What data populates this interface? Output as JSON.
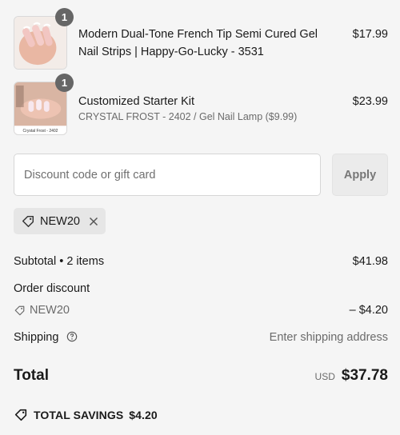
{
  "items": [
    {
      "quantity": "1",
      "title": "Modern Dual-Tone French Tip Semi Cured Gel Nail Strips | Happy-Go-Lucky - 3531",
      "subtitle": "",
      "price": "$17.99"
    },
    {
      "quantity": "1",
      "title": "Customized Starter Kit",
      "subtitle": "CRYSTAL FROST - 2402 / Gel Nail Lamp ($9.99)",
      "price": "$23.99",
      "thumb_caption": "Crystal Frost - 2402"
    }
  ],
  "discount": {
    "placeholder": "Discount code or gift card",
    "apply_label": "Apply",
    "applied_code": "NEW20"
  },
  "summary": {
    "subtotal_label": "Subtotal • 2 items",
    "subtotal_value": "$41.98",
    "order_discount_label": "Order discount",
    "discount_code": "NEW20",
    "discount_value": "– $4.20",
    "shipping_label": "Shipping",
    "shipping_value": "Enter shipping address",
    "total_label": "Total",
    "currency": "USD",
    "total_value": "$37.78",
    "savings_label": "TOTAL SAVINGS",
    "savings_value": "$4.20"
  },
  "icons": [
    "tag-icon",
    "close-icon",
    "help-icon",
    "savings-tag-icon"
  ],
  "colors": {
    "badge": "#666666",
    "chip": "#e6e6e6",
    "background": "#f5f5f5"
  }
}
